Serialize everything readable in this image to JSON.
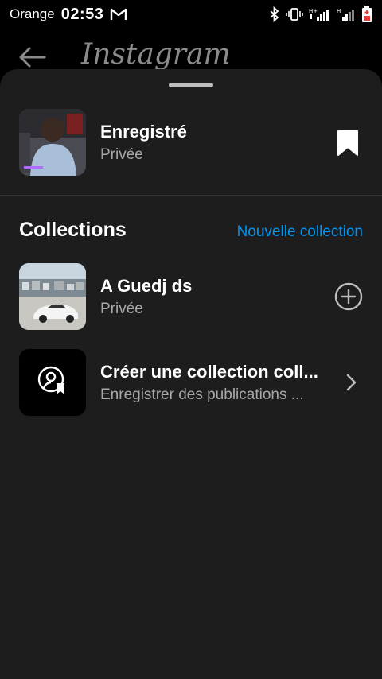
{
  "status_bar": {
    "carrier": "Orange",
    "time": "02:53",
    "icons": [
      "gmail-icon",
      "bluetooth-icon",
      "vibrate-icon",
      "signal-h-icon",
      "signal-icon",
      "battery-low-icon"
    ]
  },
  "background_header": {
    "title": "Instagram"
  },
  "saved": {
    "title": "Enregistré",
    "privacy": "Privée"
  },
  "collections": {
    "heading": "Collections",
    "new_collection_label": "Nouvelle collection",
    "items": [
      {
        "title": "A Guedj ds",
        "subtitle": "Privée"
      },
      {
        "title": "Créer une collection coll...",
        "subtitle": "Enregistrer des publications ..."
      }
    ]
  },
  "colors": {
    "sheet_background": "#1d1d1d",
    "link_blue": "#0095f6",
    "secondary_text": "#a8a8a8"
  }
}
